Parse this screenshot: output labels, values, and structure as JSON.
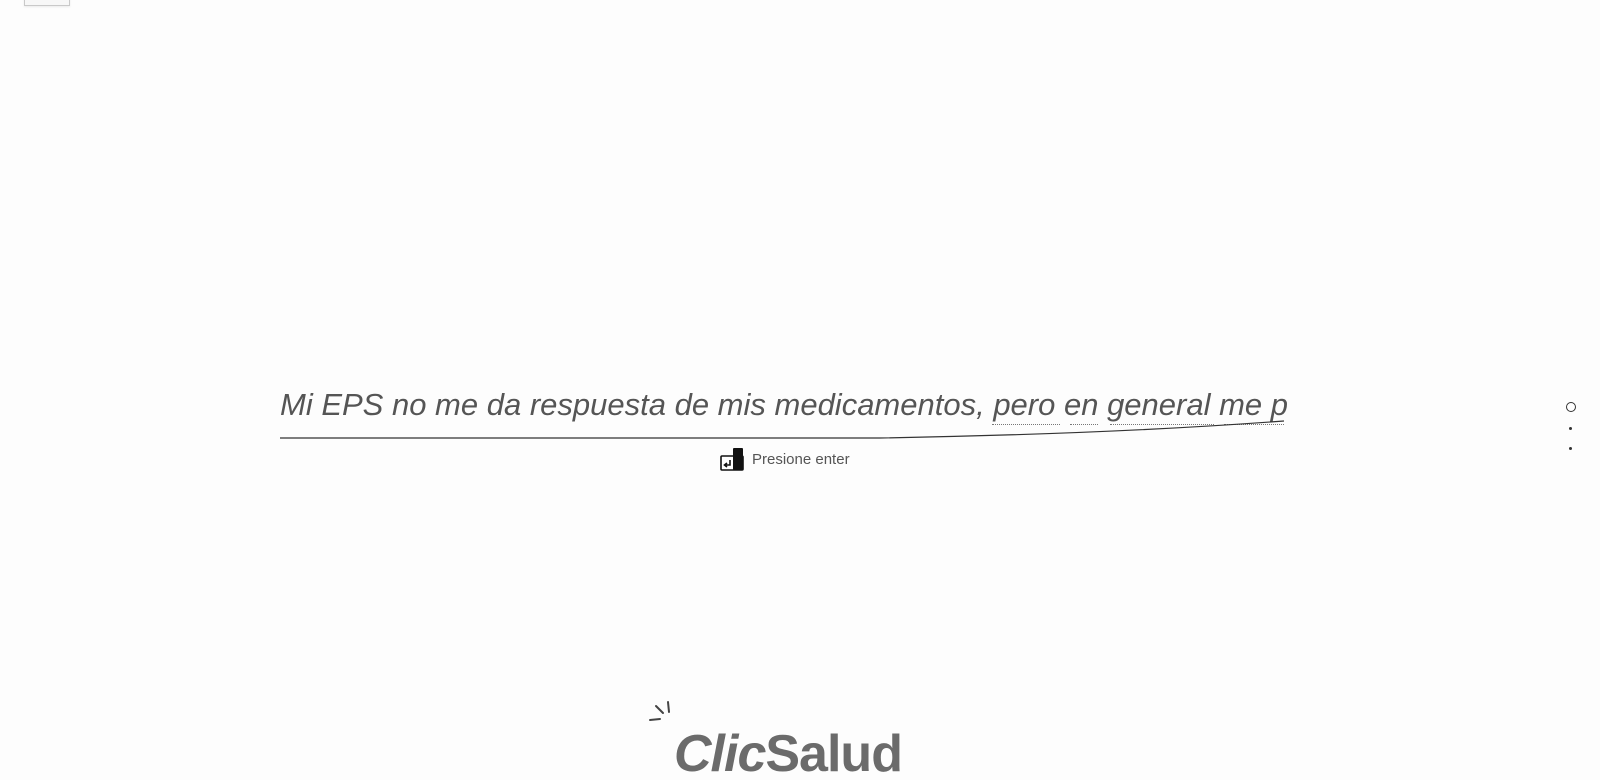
{
  "answer": {
    "value": "Mi EPS no me da respuesta de mis medicamentos, pero en general me p",
    "misspelled_words": [
      "pero",
      "en",
      "general",
      "me"
    ]
  },
  "hint": {
    "icon": "enter-key-icon",
    "label": "Presione enter"
  },
  "navigation": {
    "total_steps": 3,
    "active_step": 1
  },
  "logo": {
    "part1": "Clic",
    "part2": "Salud",
    "icon": "spark-icon"
  },
  "colors": {
    "text": "#555555",
    "logo": "#6b6b6b",
    "line": "#333333"
  }
}
